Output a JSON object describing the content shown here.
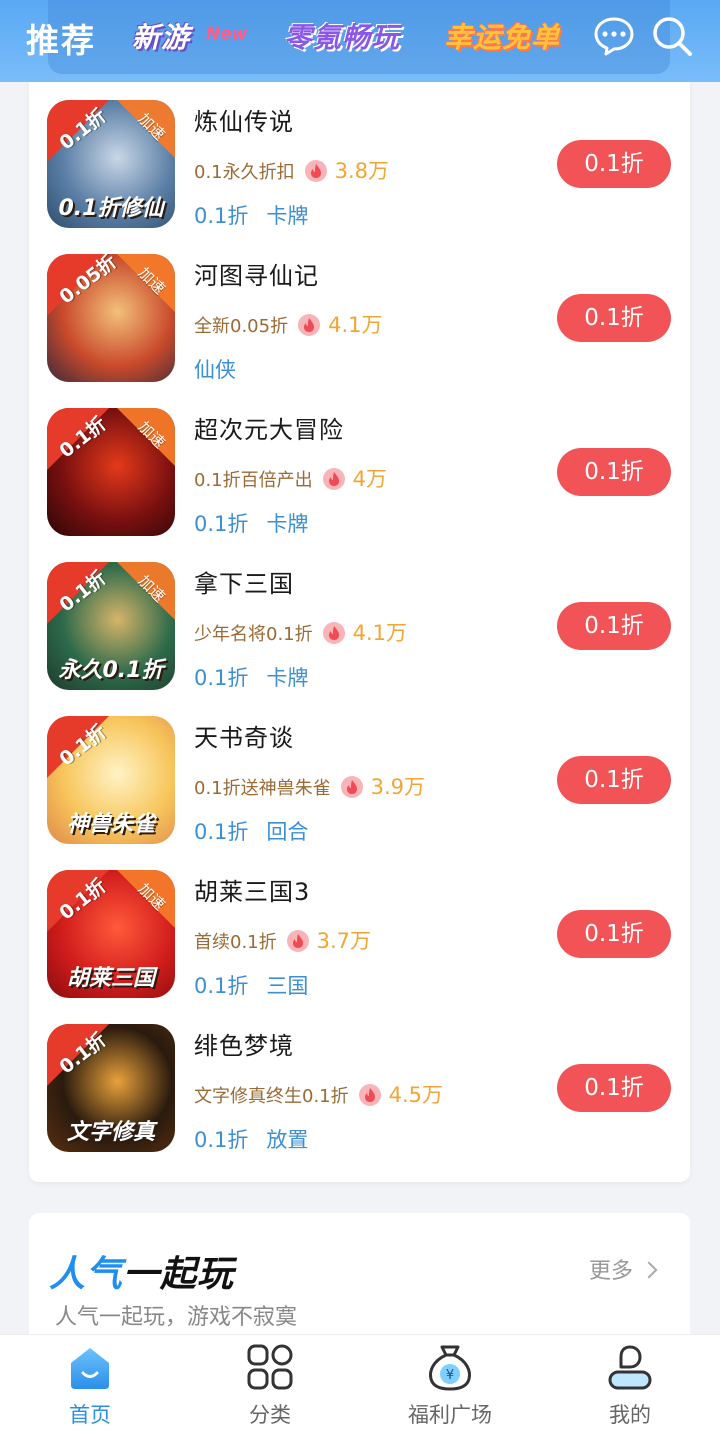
{
  "header": {
    "tabs": [
      "推荐",
      "新游",
      "零氪畅玩",
      "幸运免单"
    ],
    "new_badge": "New",
    "active_tab": "推荐"
  },
  "games": [
    {
      "name": "炼仙传说",
      "promo": "0.1永久折扣",
      "hot": "3.8万",
      "tags": [
        "0.1折",
        "卡牌"
      ],
      "button": "0.1折",
      "icon": {
        "discount": "0.1折",
        "speed": "加速",
        "caption": "0.1折修仙",
        "colors": [
          "#5b7fa6",
          "#c9d7e6",
          "#2e4e6e"
        ]
      }
    },
    {
      "name": "河图寻仙记",
      "promo": "全新0.05折",
      "hot": "4.1万",
      "tags": [
        "仙侠"
      ],
      "button": "0.1折",
      "icon": {
        "discount": "0.05折",
        "speed": "加速",
        "caption": "",
        "colors": [
          "#c94a2b",
          "#f3c07a",
          "#3a2a3a"
        ]
      }
    },
    {
      "name": "超次元大冒险",
      "promo": "0.1折百倍产出",
      "hot": "4万",
      "tags": [
        "0.1折",
        "卡牌"
      ],
      "button": "0.1折",
      "icon": {
        "discount": "0.1折",
        "speed": "加速",
        "caption": "",
        "colors": [
          "#7a1010",
          "#e33a1a",
          "#2b0606"
        ]
      }
    },
    {
      "name": "拿下三国",
      "promo": "少年名将0.1折",
      "hot": "4.1万",
      "tags": [
        "0.1折",
        "卡牌"
      ],
      "button": "0.1折",
      "icon": {
        "discount": "0.1折",
        "speed": "加速",
        "caption": "永久0.1折",
        "colors": [
          "#2d6a4a",
          "#d6b46a",
          "#1d3b2c"
        ]
      }
    },
    {
      "name": "天书奇谈",
      "promo": "0.1折送神兽朱雀",
      "hot": "3.9万",
      "tags": [
        "0.1折",
        "回合"
      ],
      "button": "0.1折",
      "icon": {
        "discount": "0.1折",
        "speed": "",
        "caption": "神兽朱雀",
        "colors": [
          "#f7c55b",
          "#fff3c4",
          "#e0894a"
        ]
      }
    },
    {
      "name": "胡莱三国3",
      "promo": "首续0.1折",
      "hot": "3.7万",
      "tags": [
        "0.1折",
        "三国"
      ],
      "button": "0.1折",
      "icon": {
        "discount": "0.1折",
        "speed": "加速",
        "caption": "胡莱三国",
        "colors": [
          "#d21d1d",
          "#ff5a3a",
          "#8a0c0c"
        ]
      }
    },
    {
      "name": "绯色梦境",
      "promo": "文字修真终生0.1折",
      "hot": "4.5万",
      "tags": [
        "0.1折",
        "放置"
      ],
      "button": "0.1折",
      "icon": {
        "discount": "0.1折",
        "speed": "",
        "caption": "文字修真",
        "colors": [
          "#2a1a0e",
          "#e8a23a",
          "#5a3010"
        ]
      }
    }
  ],
  "popular": {
    "title_accent": "人气",
    "title_rest": "一起玩",
    "subtitle": "人气一起玩，游戏不寂寞",
    "more": "更多"
  },
  "nav": [
    {
      "label": "首页",
      "icon": "home-icon",
      "active": true
    },
    {
      "label": "分类",
      "icon": "category-icon",
      "active": false
    },
    {
      "label": "福利广场",
      "icon": "money-bag-icon",
      "active": false
    },
    {
      "label": "我的",
      "icon": "profile-icon",
      "active": false
    }
  ],
  "colors": {
    "header": "#5aa8f4",
    "button": "#f25356",
    "tag": "#3d8fd4",
    "hot": "#f2a535",
    "promo": "#9a6b36",
    "nav_active": "#2b8fe8"
  }
}
